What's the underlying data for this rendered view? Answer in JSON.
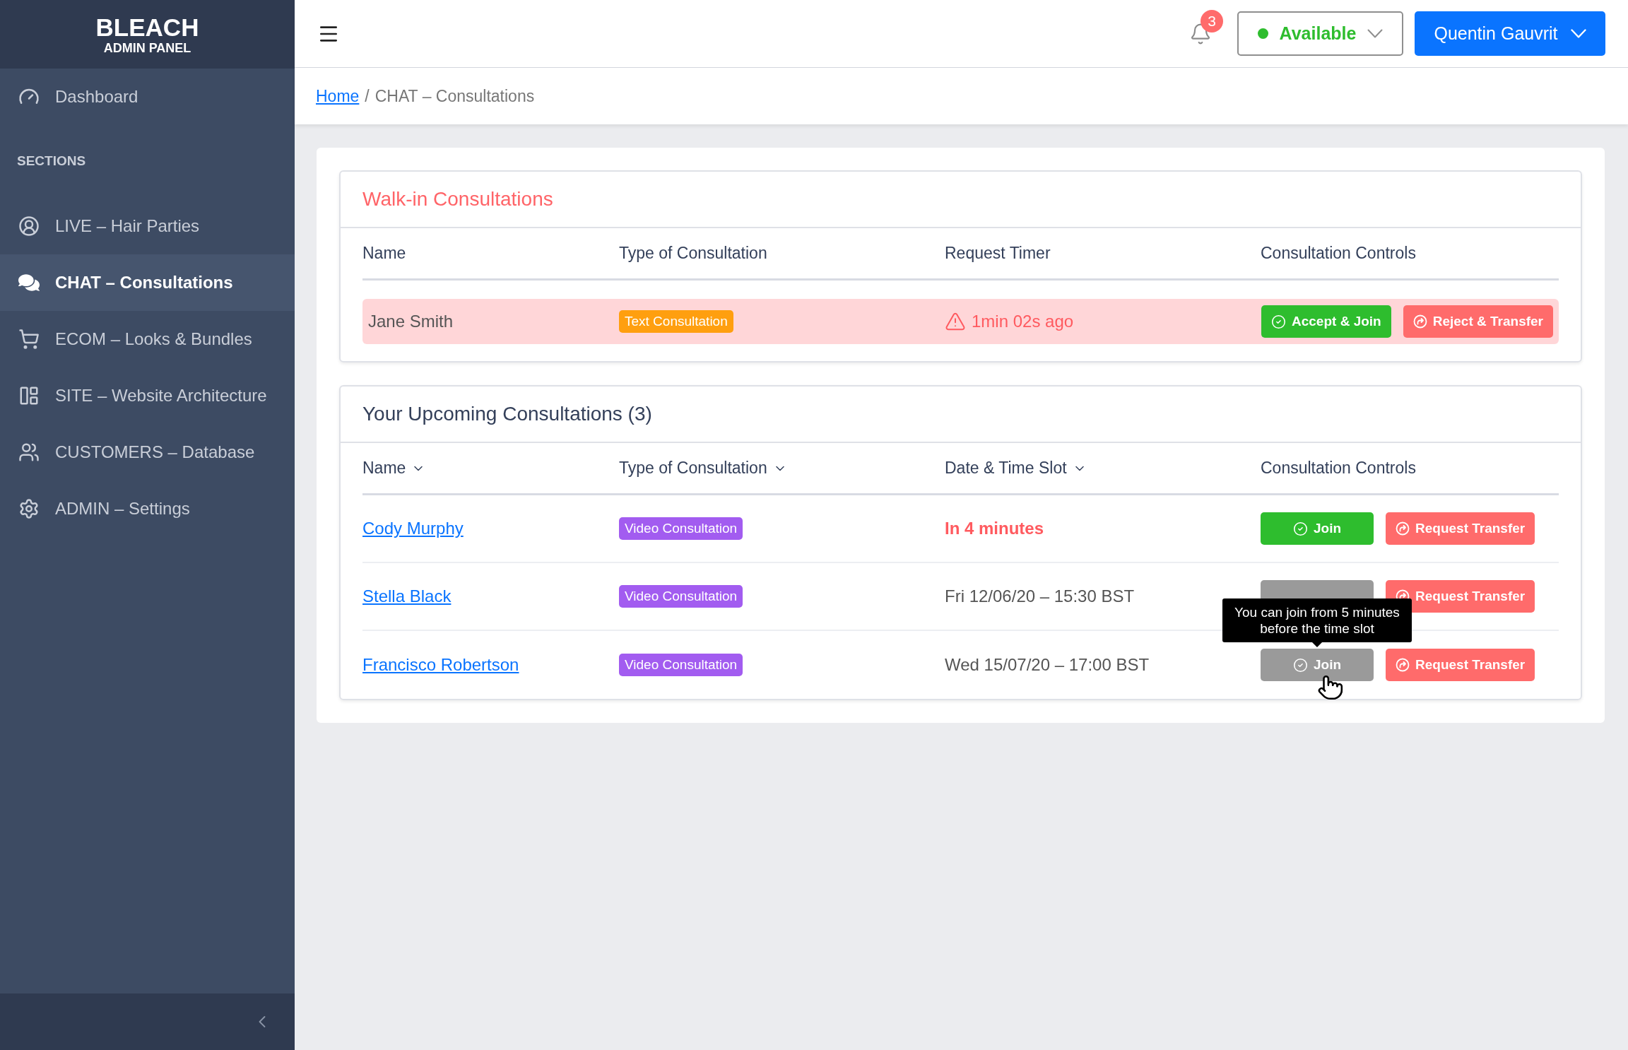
{
  "sidebar": {
    "brand": "BLEACH",
    "subtitle": "ADMIN PANEL",
    "top_items": [
      {
        "label": "Dashboard",
        "selected": false
      }
    ],
    "section_title": "SECTIONS",
    "items": [
      {
        "label": "LIVE – Hair Parties",
        "selected": false
      },
      {
        "label": "CHAT – Consultations",
        "selected": true
      },
      {
        "label": "ECOM – Looks & Bundles",
        "selected": false
      },
      {
        "label": "SITE – Website Architecture",
        "selected": false
      },
      {
        "label": "CUSTOMERS – Database",
        "selected": false
      },
      {
        "label": "ADMIN – Settings",
        "selected": false
      }
    ]
  },
  "header": {
    "notifications": "3",
    "status": {
      "label": "Available",
      "color": "#2ebd2e"
    },
    "user": "Quentin Gauvrit"
  },
  "breadcrumb": {
    "separator": "/",
    "items": [
      {
        "label": "Home",
        "link": true
      },
      {
        "label": "CHAT – Consultations",
        "link": false
      }
    ]
  },
  "walk_in": {
    "title": "Walk-in Consultations",
    "columns": [
      {
        "label": "Name",
        "sortable": false
      },
      {
        "label": "Type of Consultation",
        "sortable": false
      },
      {
        "label": "Request Timer",
        "sortable": false
      },
      {
        "label": "Consultation Controls",
        "sortable": false
      }
    ],
    "rows": [
      {
        "name": "Jane Smith",
        "highlighted": true,
        "type": {
          "label": "Text Consultation",
          "color": "#ff9f0f"
        },
        "timer": {
          "text": "1min 02s ago",
          "alert": true
        },
        "actions": [
          {
            "kind": "accept",
            "label": "Accept & Join",
            "disabled": false
          },
          {
            "kind": "transfer",
            "label": "Reject & Transfer",
            "disabled": false
          }
        ]
      }
    ]
  },
  "upcoming": {
    "title": "Your Upcoming Consultations (3)",
    "columns": [
      {
        "label": "Name",
        "sortable": true
      },
      {
        "label": "Type of Consultation",
        "sortable": true
      },
      {
        "label": "Date & Time Slot",
        "sortable": true
      },
      {
        "label": "Consultation Controls",
        "sortable": false
      }
    ],
    "rows": [
      {
        "name": "Cody Murphy",
        "type": {
          "label": "Video Consultation",
          "color": "#a25cf0"
        },
        "slot": {
          "text": "In 4 minutes",
          "urgent": true
        },
        "actions": [
          {
            "kind": "accept",
            "label": "Join",
            "disabled": false
          },
          {
            "kind": "transfer",
            "label": "Request Transfer",
            "disabled": false
          }
        ]
      },
      {
        "name": "Stella Black",
        "type": {
          "label": "Video Consultation",
          "color": "#a25cf0"
        },
        "slot": {
          "text": "Fri 12/06/20 – 15:30 BST",
          "urgent": false
        },
        "actions": [
          {
            "kind": "accept",
            "disabled": true
          },
          {
            "kind": "transfer",
            "label": "Request Transfer",
            "disabled": false
          }
        ]
      },
      {
        "name": "Francisco Robertson",
        "type": {
          "label": "Video Consultation",
          "color": "#a25cf0"
        },
        "slot": {
          "text": "Wed 15/07/20 – 17:00 BST",
          "urgent": false
        },
        "actions": [
          {
            "kind": "accept",
            "label": "Join",
            "disabled": true,
            "hovered": true,
            "tooltip": "You can join from 5 minutes before the time slot"
          },
          {
            "kind": "transfer",
            "label": "Request Transfer",
            "disabled": false
          }
        ]
      }
    ]
  }
}
